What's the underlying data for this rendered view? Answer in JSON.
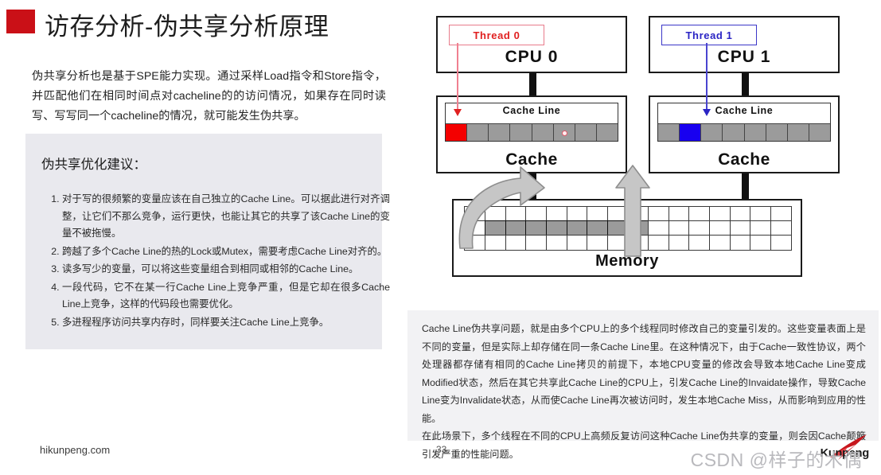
{
  "slide": {
    "title": "访存分析-伪共享分析原理",
    "page_number": "33",
    "accent_color": "#ca1017"
  },
  "intro": {
    "paragraph": "伪共享分析也是基于SPE能力实现。通过采样Load指令和Store指令，并匹配他们在相同时间点对cacheline的的访问情况，如果存在同时读写、写写同一个cacheline的情况，就可能发生伪共享。"
  },
  "advice": {
    "title": "伪共享优化建议：",
    "items": [
      "对于写的很频繁的变量应该在自己独立的Cache Line。可以据此进行对齐调整，让它们不那么竞争，运行更快，也能让其它的共享了该Cache Line的变量不被拖慢。",
      "跨越了多个Cache Line的热的Lock或Mutex，需要考虑Cache Line对齐的。",
      "读多写少的变量，可以将这些变量组合到相同或相邻的Cache Line。",
      "一段代码，它不在某一行Cache Line上竞争严重，但是它却在很多Cache Line上竞争，这样的代码段也需要优化。",
      "多进程程序访问共享内存时，同样要关注Cache Line上竞争。"
    ]
  },
  "diagram": {
    "cpus": [
      {
        "cpu_label": "CPU 0",
        "thread_label": "Thread 0",
        "thread_color": "#e02020",
        "cache_label": "Cache",
        "cacheline_label": "Cache Line",
        "cell_count": 8,
        "highlight_index": 0,
        "highlight_color": "#f40000",
        "dot_index": 5
      },
      {
        "cpu_label": "CPU 1",
        "thread_label": "Thread 1",
        "thread_color": "#2a24c4",
        "cache_label": "Cache",
        "cacheline_label": "Cache Line",
        "cell_count": 8,
        "highlight_index": 1,
        "highlight_color": "#1800f0",
        "dot_index": -1
      }
    ],
    "memory": {
      "label": "Memory",
      "columns": 16,
      "rows": 3,
      "shared_row": 1,
      "shared_start": 1,
      "shared_end": 8
    }
  },
  "explanation": {
    "paragraphs": [
      "Cache Line伪共享问题，就是由多个CPU上的多个线程同时修改自己的变量引发的。这些变量表面上是不同的变量，但是实际上却存储在同一条Cache Line里。在这种情况下，由于Cache一致性协议，两个处理器都存储有相同的Cache Line拷贝的前提下，本地CPU变量的修改会导致本地Cache Line变成Modified状态，然后在其它共享此Cache Line的CPU上，引发Cache Line的Invaidate操作，导致Cache Line变为Invalidate状态，从而使Cache Line再次被访问时，发生本地Cache Miss，从而影响到应用的性能。",
      "在此场景下，多个线程在不同的CPU上高频反复访问这种Cache Line伪共享的变量，则会因Cache颠簸引发严重的性能问题。"
    ]
  },
  "footer": {
    "site": "hikunpeng.com",
    "brand": "Kunpeng",
    "watermark": "CSDN @样子的木偶"
  }
}
